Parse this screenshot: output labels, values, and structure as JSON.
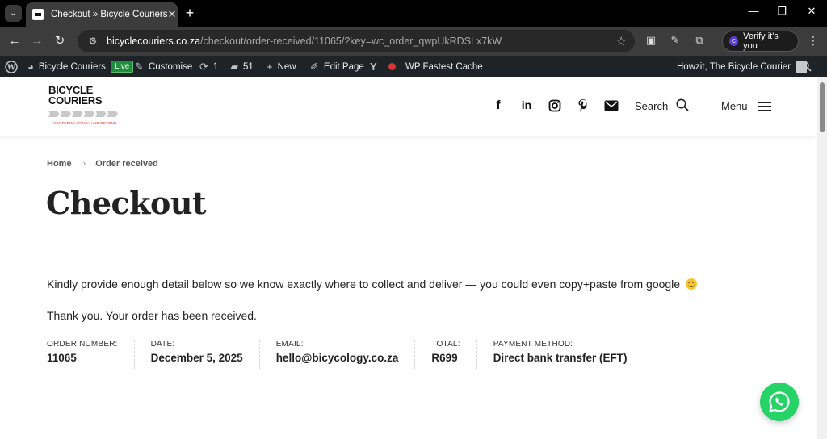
{
  "browser": {
    "tab_title": "Checkout » Bicycle Couriers",
    "url_host": "bicyclecouriers.co.za",
    "url_path": "/checkout/order-received/11065/?key=wc_order_qwpUkRDSLx7kW",
    "verify_label": "Verify it's you",
    "verify_badge": "C"
  },
  "adminbar": {
    "site_name": "Bicycle Couriers",
    "live_badge": "Live",
    "customise": "Customise",
    "updates_count": "1",
    "comments_count": "51",
    "new_label": "New",
    "edit_page": "Edit Page",
    "cache_label": "WP Fastest Cache",
    "greeting": "Howzit, The Bicycle Courier"
  },
  "header": {
    "logo_line1": "BICYCLE",
    "logo_line2": "COURIERS",
    "logo_tagline": "SOUTHERN AFRICA AND BEYOND",
    "search_label": "Search",
    "menu_label": "Menu"
  },
  "breadcrumb": {
    "home": "Home",
    "current": "Order received"
  },
  "page": {
    "title": "Checkout",
    "note": "Kindly provide enough detail below so we know exactly where to collect and deliver — you could even copy+paste from google",
    "thanks": "Thank you. Your order has been received."
  },
  "order": {
    "number_label": "ORDER NUMBER:",
    "number": "11065",
    "date_label": "DATE:",
    "date": "December 5, 2025",
    "email_label": "EMAIL:",
    "email": "hello@bicycology.co.za",
    "total_label": "TOTAL:",
    "total": "R699",
    "payment_label": "PAYMENT METHOD:",
    "payment": "Direct bank transfer (EFT)"
  },
  "colors": {
    "admin_bar": "#1d2327",
    "live_green": "#1e8e3e",
    "whatsapp_green": "#25d366"
  }
}
